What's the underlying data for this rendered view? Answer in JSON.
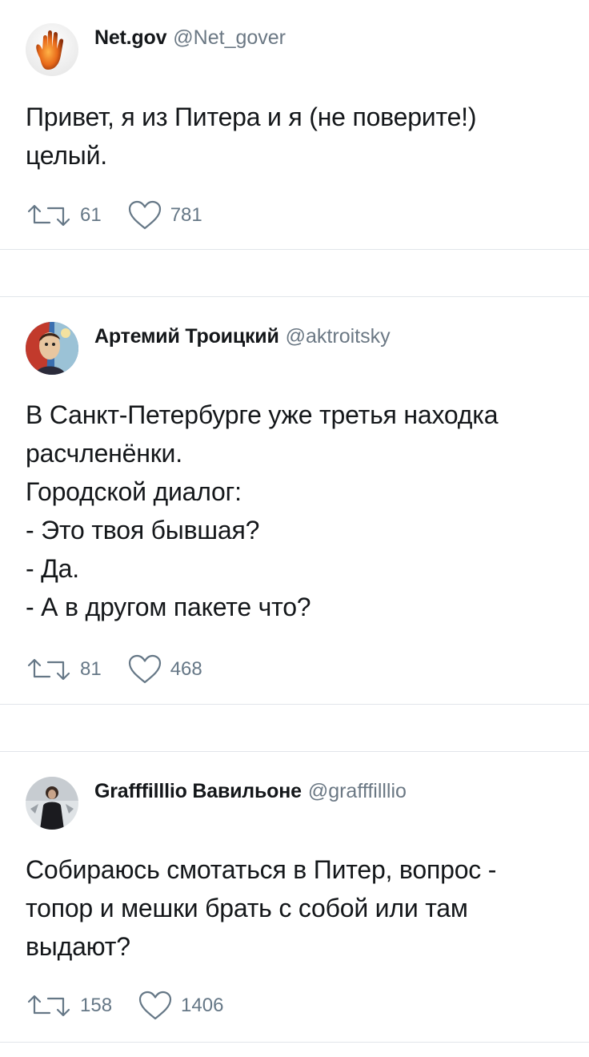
{
  "tweets": [
    {
      "name": "Net.gov",
      "handle": "@Net_gover",
      "avatar_icon": "raised-hand-avatar",
      "lines": [
        "Привет, я из Питера и я (не поверите!)",
        "целый."
      ],
      "retweets": "61",
      "likes": "781"
    },
    {
      "name": "Артемий Троицкий",
      "handle": "@aktroitsky",
      "avatar_icon": "painted-portrait-avatar",
      "lines": [
        "В Санкт-Петербурге уже третья находка",
        "расчленёнки.",
        "Городской диалог:",
        "- Это твоя бывшая?",
        "- Да.",
        "- А в другом пакете что?"
      ],
      "retweets": "81",
      "likes": "468"
    },
    {
      "name": "Grafffilllio Вавильоне",
      "handle": "@grafffilllio",
      "avatar_icon": "dark-figure-avatar",
      "lines": [
        "Собираюсь смотаться в Питер, вопрос -",
        "топор и мешки брать с собой или там",
        "выдают?"
      ],
      "retweets": "158",
      "likes": "1406"
    }
  ],
  "colors": {
    "text": "#14171a",
    "secondary": "#657786",
    "divider": "#e1e5ea"
  }
}
